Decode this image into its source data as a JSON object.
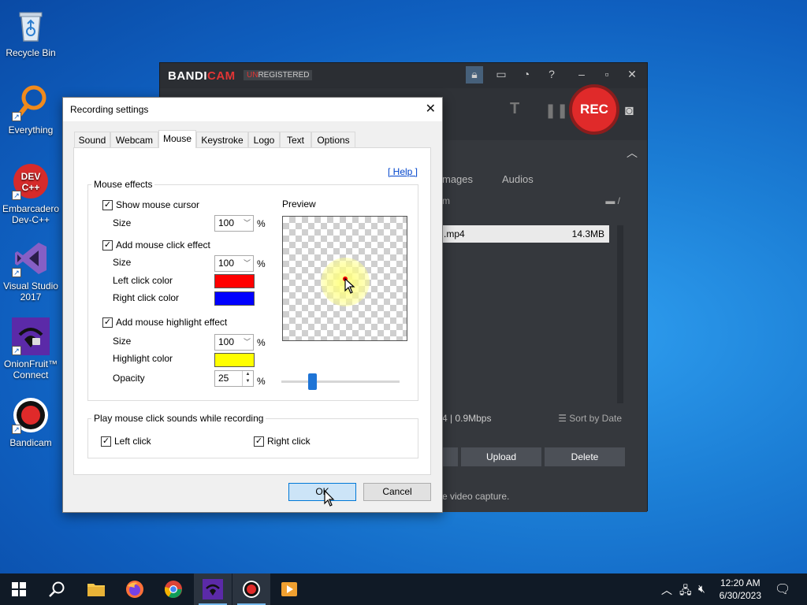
{
  "desktop": {
    "icons": [
      {
        "label": "Recycle Bin"
      },
      {
        "label": "Everything"
      },
      {
        "label": "Embarcadero Dev-C++",
        "logo_text": "DEV C++"
      },
      {
        "label": "Visual Studio 2017"
      },
      {
        "label": "OnionFruit™ Connect"
      },
      {
        "label": "Bandicam"
      }
    ]
  },
  "bandicam": {
    "brand_a": "BANDI",
    "brand_b": "CAM",
    "unregistered_a": "UN",
    "unregistered_b": "REGISTERED",
    "rec_label": "REC",
    "tab_images": "mages",
    "tab_audios": "Audios",
    "path_text": "m",
    "path_suffix": "/",
    "file_name": ".mp4",
    "file_size": "14.3MB",
    "info_text": "4 | 0.9Mbps",
    "sort_label": "Sort by Date",
    "upload_label": "Upload",
    "delete_label": "Delete",
    "hint_text": "e video capture."
  },
  "dialog": {
    "title": "Recording settings",
    "tabs": [
      "Sound",
      "Webcam",
      "Mouse",
      "Keystroke",
      "Logo",
      "Text",
      "Options"
    ],
    "active_tab": "Mouse",
    "help_label": "[ Help ]",
    "mouse_effects": {
      "group_label": "Mouse effects",
      "show_cursor_label": "Show mouse cursor",
      "show_cursor_checked": true,
      "cursor_size_label": "Size",
      "cursor_size_value": "100",
      "click_effect_label": "Add mouse click effect",
      "click_effect_checked": true,
      "click_size_label": "Size",
      "click_size_value": "100",
      "left_click_color_label": "Left click color",
      "left_click_color": "#ff0000",
      "right_click_color_label": "Right click color",
      "right_click_color": "#0000ff",
      "highlight_label": "Add mouse highlight effect",
      "highlight_checked": true,
      "highlight_size_label": "Size",
      "highlight_size_value": "100",
      "highlight_color_label": "Highlight color",
      "highlight_color": "#ffff00",
      "opacity_label": "Opacity",
      "opacity_value": "25",
      "percent": "%",
      "preview_label": "Preview"
    },
    "click_sounds": {
      "group_label": "Play mouse click sounds while recording",
      "left_click_label": "Left click",
      "left_click_checked": true,
      "right_click_label": "Right click",
      "right_click_checked": true
    },
    "ok_label": "OK",
    "cancel_label": "Cancel"
  },
  "taskbar": {
    "time": "12:20 AM",
    "date": "6/30/2023"
  },
  "colors": {
    "accent": "#0078d7",
    "rec_red": "#e02a2a"
  }
}
